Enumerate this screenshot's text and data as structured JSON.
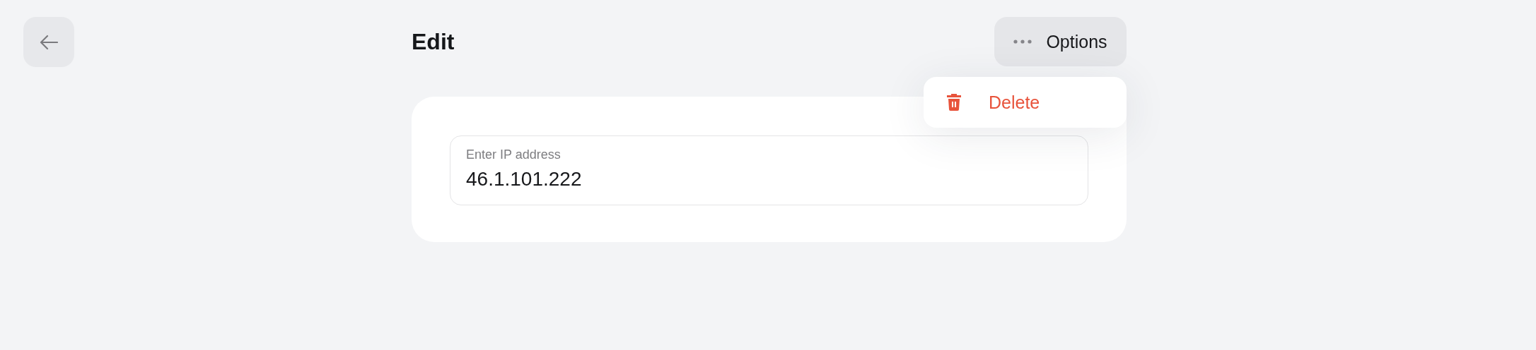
{
  "header": {
    "title": "Edit"
  },
  "options_button": {
    "label": "Options",
    "expanded": true
  },
  "options_menu": [
    {
      "label": "Delete",
      "kind": "danger"
    }
  ],
  "ip_field": {
    "label": "Enter IP address",
    "value": "46.1.101.222"
  }
}
